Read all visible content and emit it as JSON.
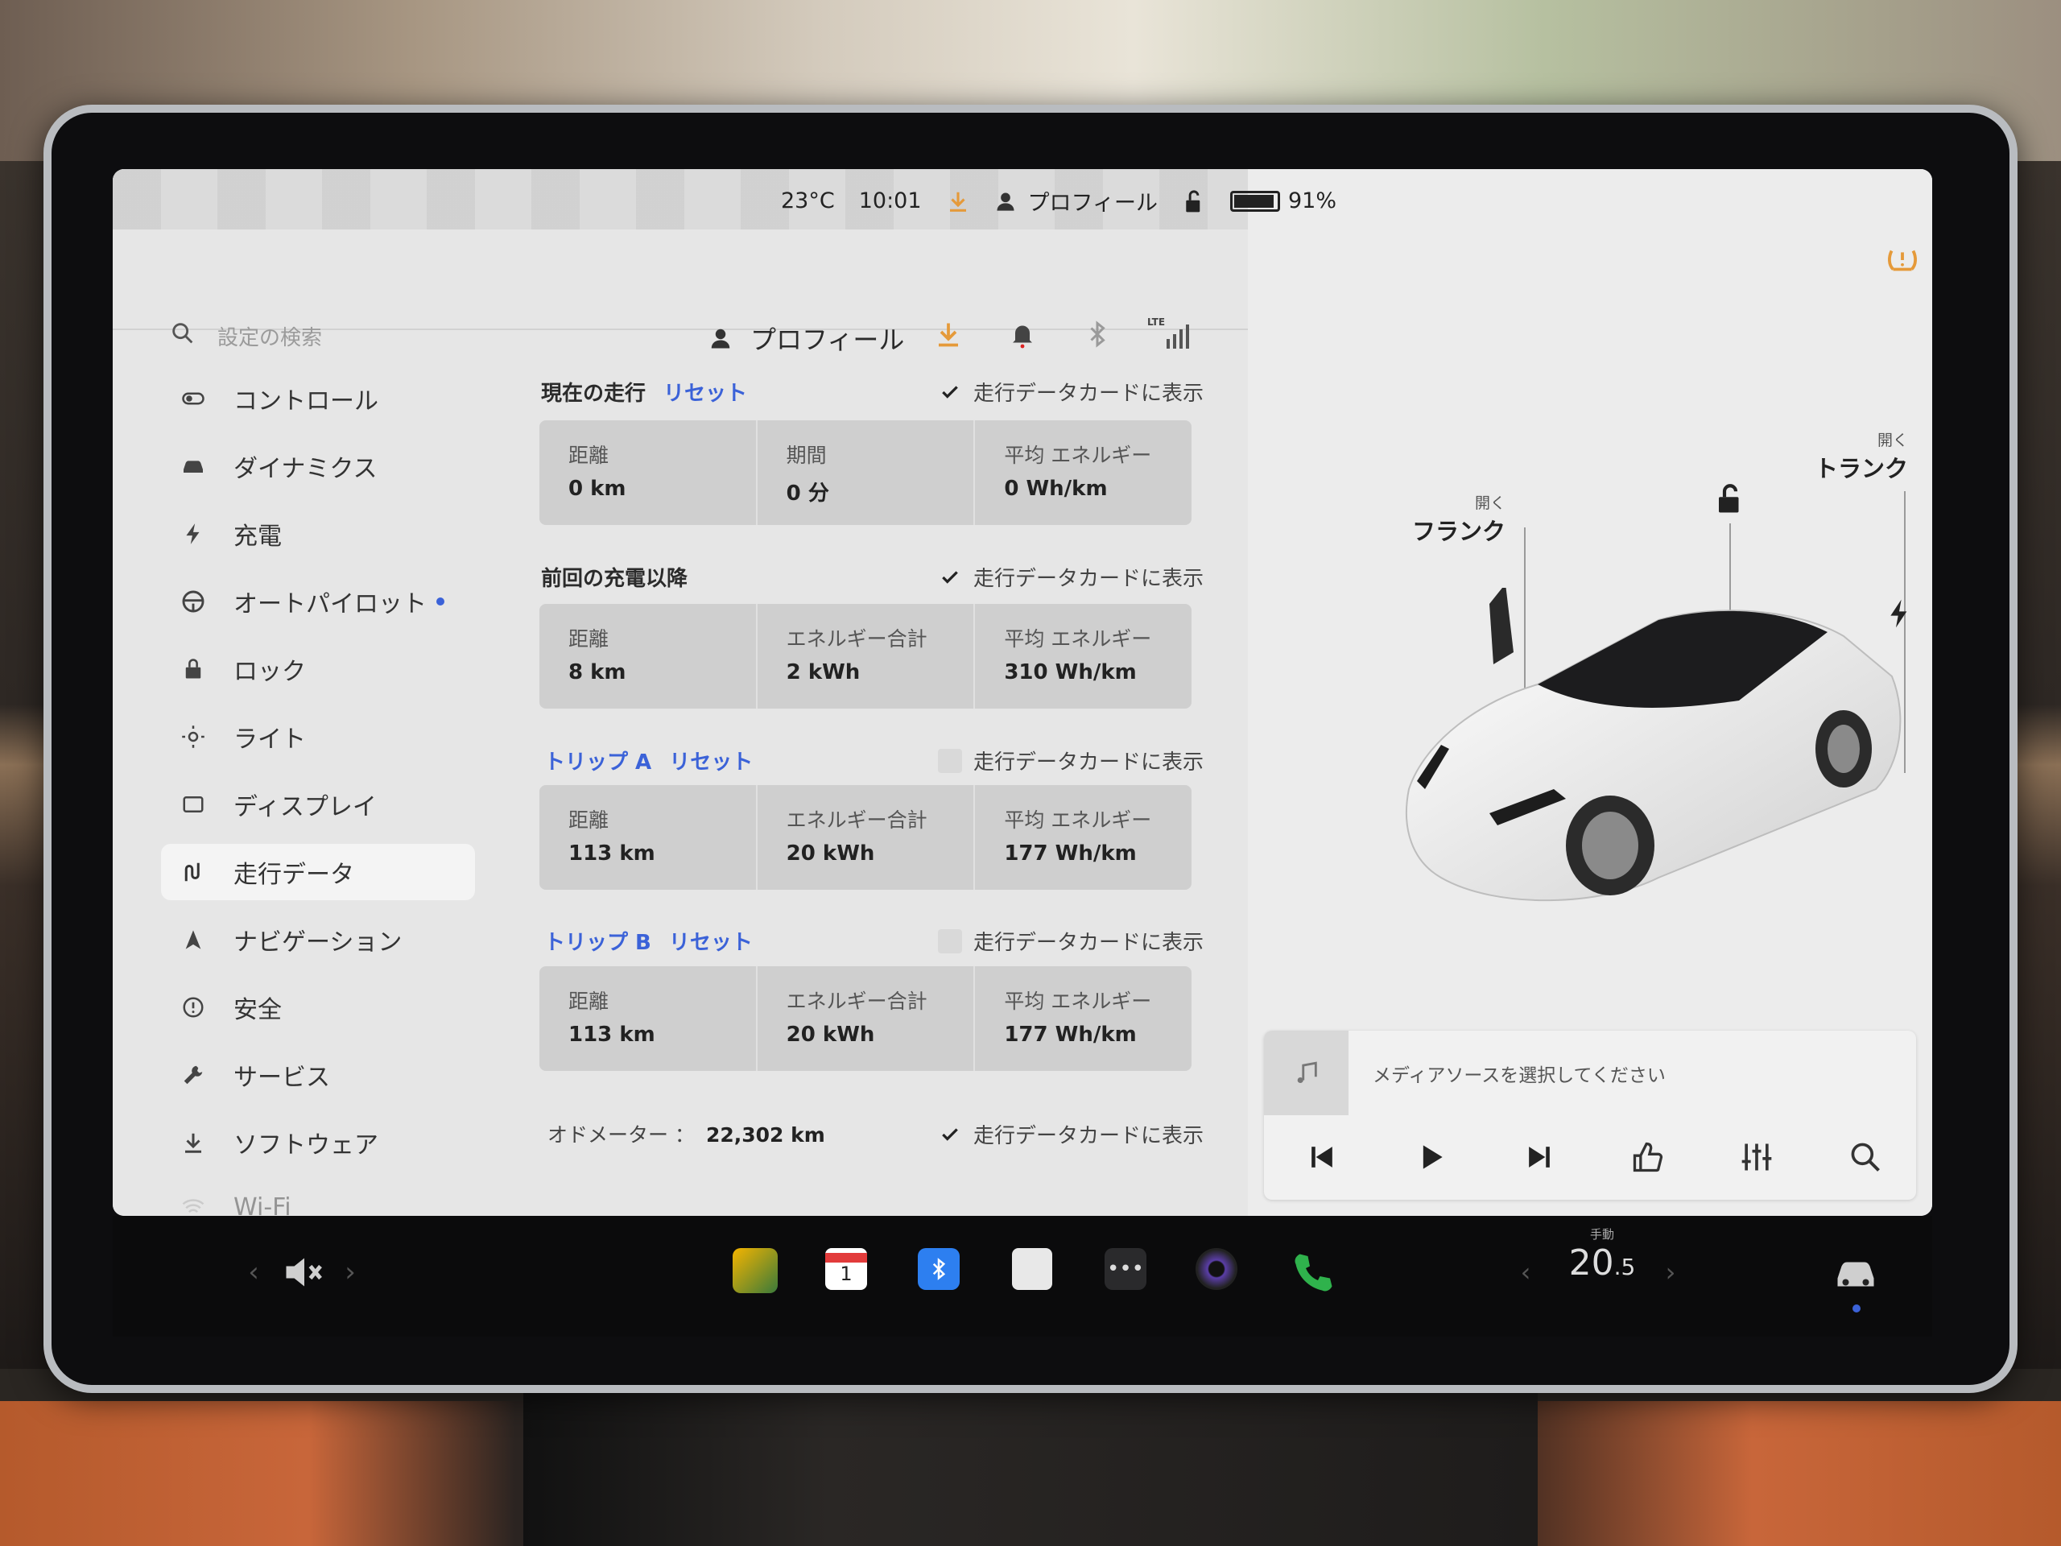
{
  "status": {
    "temperature": "23°C",
    "time": "10:01",
    "profile": "プロフィール",
    "battery_percent": "91%",
    "battery_level": 0.91
  },
  "header": {
    "search_placeholder": "設定の検索",
    "profile": "プロフィール",
    "lte": "LTE"
  },
  "sidebar": {
    "items": [
      {
        "label": "コントロール",
        "icon": "toggle-icon"
      },
      {
        "label": "ダイナミクス",
        "icon": "car-icon"
      },
      {
        "label": "充電",
        "icon": "bolt-icon"
      },
      {
        "label": "オートパイロット",
        "icon": "steering-wheel-icon"
      },
      {
        "label": "ロック",
        "icon": "lock-icon"
      },
      {
        "label": "ライト",
        "icon": "light-icon"
      },
      {
        "label": "ディスプレイ",
        "icon": "display-icon"
      },
      {
        "label": "走行データ",
        "icon": "trip-icon"
      },
      {
        "label": "ナビゲーション",
        "icon": "navigation-icon"
      },
      {
        "label": "安全",
        "icon": "safety-icon"
      },
      {
        "label": "サービス",
        "icon": "wrench-icon"
      },
      {
        "label": "ソフトウェア",
        "icon": "download-icon"
      },
      {
        "label": "Wi-Fi",
        "icon": "wifi-icon"
      }
    ],
    "active_index": 7
  },
  "trips": {
    "show_on_card_label": "走行データカードに表示",
    "reset_label": "リセット",
    "current": {
      "title": "現在の走行",
      "checked": true,
      "cells": [
        {
          "label": "距離",
          "value": "0 km"
        },
        {
          "label": "期間",
          "value": "0 分"
        },
        {
          "label": "平均 エネルギー",
          "value": "0 Wh/km"
        }
      ]
    },
    "since_charge": {
      "title": "前回の充電以降",
      "checked": true,
      "cells": [
        {
          "label": "距離",
          "value": "8 km"
        },
        {
          "label": "エネルギー合計",
          "value": "2 kWh"
        },
        {
          "label": "平均 エネルギー",
          "value": "310 Wh/km"
        }
      ]
    },
    "trip_a": {
      "title": "トリップ A",
      "checked": false,
      "cells": [
        {
          "label": "距離",
          "value": "113 km"
        },
        {
          "label": "エネルギー合計",
          "value": "20 kWh"
        },
        {
          "label": "平均 エネルギー",
          "value": "177 Wh/km"
        }
      ]
    },
    "trip_b": {
      "title": "トリップ B",
      "checked": false,
      "cells": [
        {
          "label": "距離",
          "value": "113 km"
        },
        {
          "label": "エネルギー合計",
          "value": "20 kWh"
        },
        {
          "label": "平均 エネルギー",
          "value": "177 Wh/km"
        }
      ]
    },
    "odometer": {
      "label": "オドメーター ：",
      "value": "22,302 km",
      "checked": true
    }
  },
  "car": {
    "frunk_action": "開く",
    "frunk_label": "フランク",
    "trunk_action": "開く",
    "trunk_label": "トランク"
  },
  "media": {
    "prompt": "メディアソースを選択してください"
  },
  "taskbar": {
    "calendar_day": "1",
    "climate_mode": "手動",
    "temp_whole": "20",
    "temp_decimal": ".5"
  },
  "colors": {
    "accent_blue": "#3b62d8",
    "warning_orange": "#e59a3a",
    "call_green": "#2fb24c"
  }
}
